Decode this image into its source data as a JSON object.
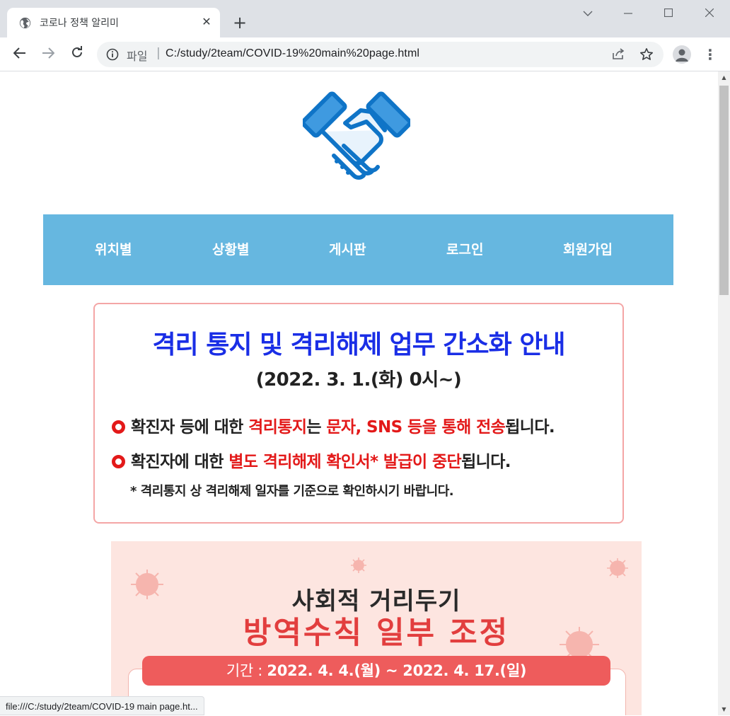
{
  "browser": {
    "tab_title": "코로나 정책 알리미",
    "tab_favicon": "globe-icon",
    "address_scheme": "파일",
    "address_separator": "|",
    "url": "C:/study/2team/COVID-19%20main%20page.html",
    "status_url": "file:///C:/study/2team/COVID-19 main page.ht..."
  },
  "page": {
    "logo": "handshake-icon",
    "brand_color": "#66b7e0",
    "nav": [
      {
        "label": "위치별"
      },
      {
        "label": "상황별"
      },
      {
        "label": "게시판"
      },
      {
        "label": "로그인"
      },
      {
        "label": "회원가입"
      }
    ],
    "notice": {
      "title": "격리 통지 및 격리해제 업무 간소화 안내",
      "date": "(2022. 3. 1.(화) 0시~)",
      "bullet1": {
        "p1": "확진자 등에 대한 ",
        "r1": "격리통지",
        "p2": "는 ",
        "r2": "문자, SNS 등을 통해 전송",
        "p3": "됩니다."
      },
      "bullet2": {
        "p1": "확진자에 대한 ",
        "r1": "별도 격리해제 확인서* 발급이 중단",
        "p2": "됩니다."
      },
      "footnote": "* 격리통지 상 격리해제 일자를 기준으로 확인하시기 바랍니다."
    },
    "poster": {
      "line1": "사회적 거리두기",
      "line2": "방역수칙 일부 조정",
      "period_label": "기간 : ",
      "period_value": "2022. 4. 4.(월) ~ 2022. 4. 17.(일)"
    }
  }
}
